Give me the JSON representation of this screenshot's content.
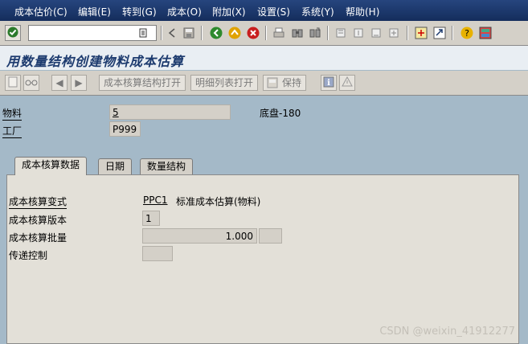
{
  "menu": [
    {
      "label": "成本估价(C)"
    },
    {
      "label": "编辑(E)"
    },
    {
      "label": "转到(G)"
    },
    {
      "label": "成本(O)"
    },
    {
      "label": "附加(X)"
    },
    {
      "label": "设置(S)"
    },
    {
      "label": "系统(Y)"
    },
    {
      "label": "帮助(H)"
    }
  ],
  "command_field": {
    "value": ""
  },
  "title": "用数量结构创建物料成本估算",
  "app_toolbar": {
    "costing_structure_btn": "成本核算结构打开",
    "detail_list_btn": "明细列表打开",
    "save_btn": "保持"
  },
  "header": {
    "material_label": "物料",
    "material_value": "5",
    "material_desc": "底盘-180",
    "plant_label": "工厂",
    "plant_value": "P999"
  },
  "tabs": [
    {
      "label": "成本核算数据",
      "active": true
    },
    {
      "label": "日期",
      "active": false
    },
    {
      "label": "数量结构",
      "active": false
    }
  ],
  "costing_data": {
    "variant_label": "成本核算变式",
    "variant_value": "PPC1",
    "variant_desc": "标准成本估算(物料)",
    "version_label": "成本核算版本",
    "version_value": "1",
    "lot_size_label": "成本核算批量",
    "lot_size_value": "1.000",
    "transfer_label": "传递控制",
    "transfer_value": ""
  },
  "watermark": "CSDN @weixin_41912277",
  "colors": {
    "menubar": "#1c3a6e",
    "background": "#a4b9c8",
    "panel": "#e3e0d8",
    "title": "#1c3a6e"
  }
}
